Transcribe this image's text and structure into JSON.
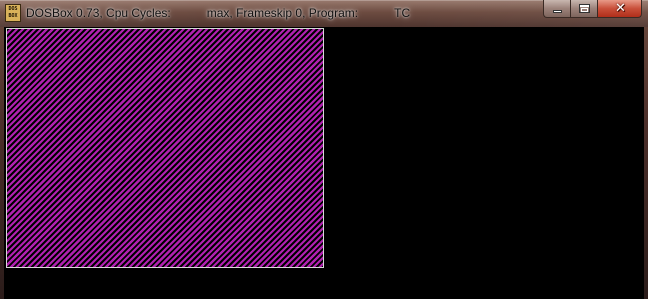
{
  "window": {
    "icon": {
      "name": "dosbox-icon",
      "text_line1": "DOS",
      "text_line2": "BOX"
    },
    "title": {
      "app": "DOSBox 0.73, Cpu Cycles:",
      "cycles": "max, Frameskip  0, Program:",
      "program": "TC"
    },
    "buttons": {
      "minimize": "minimize-icon",
      "maximize": "maximize-icon",
      "close": "close-icon",
      "close_glyph": "✕"
    }
  },
  "screen": {
    "background": "#000000",
    "pattern_colors": [
      "#000000",
      "#b020b0"
    ],
    "border_color": "#d8d8d8"
  }
}
